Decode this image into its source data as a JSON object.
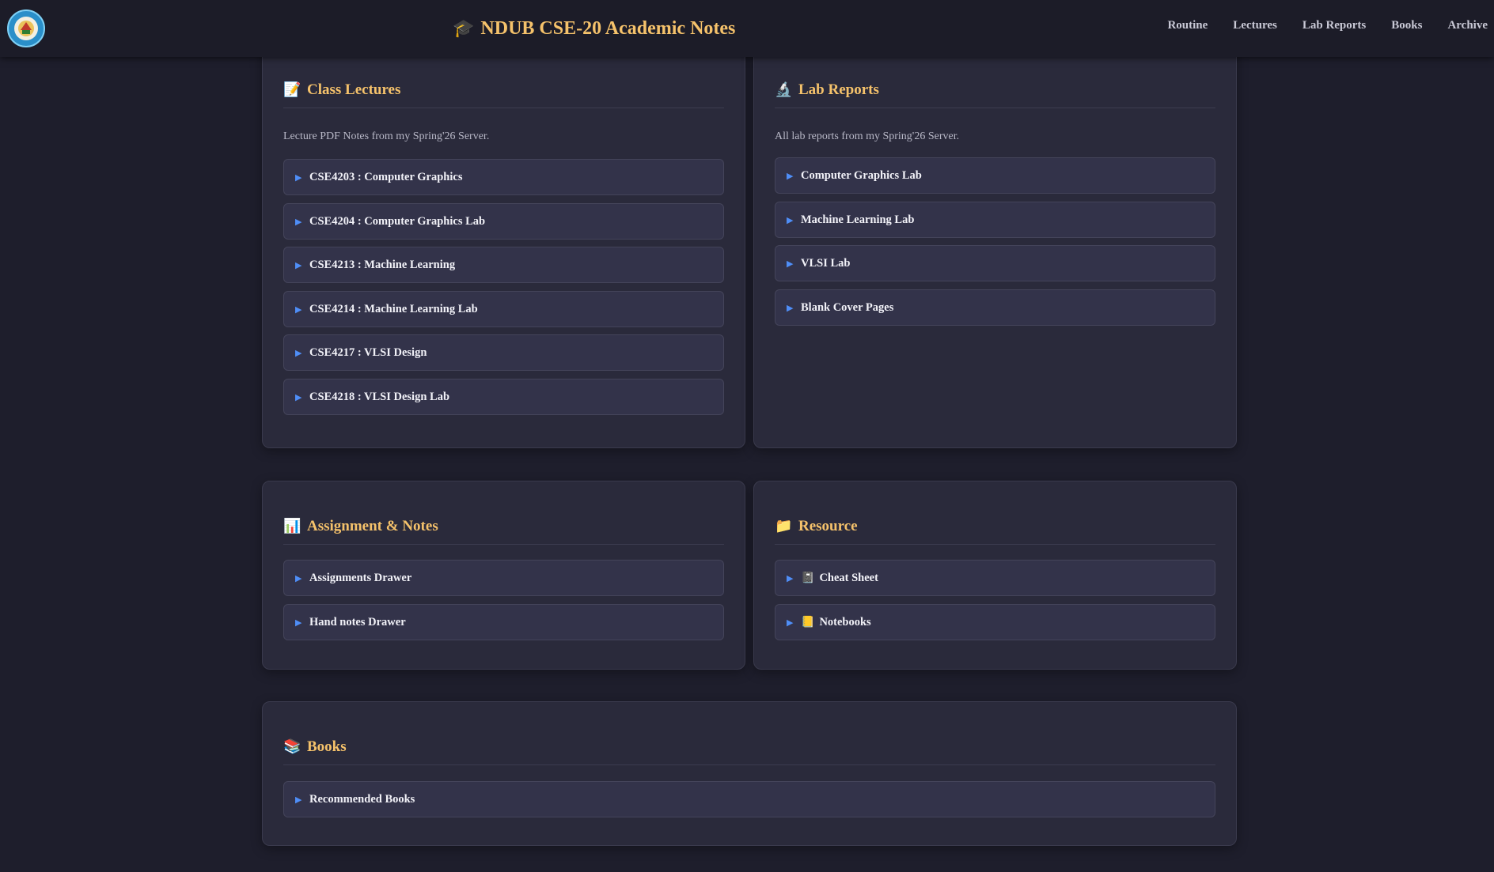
{
  "header": {
    "title": "NDUB CSE-20 Academic Notes",
    "title_icon": "graduation-cap-icon",
    "nav": [
      "Routine",
      "Lectures",
      "Lab Reports",
      "Books",
      "Archive"
    ]
  },
  "colors": {
    "background": "#1e1e2c",
    "card": "#2a2a3b",
    "item": "#33334a",
    "accent_title": "#f5c26b",
    "arrow": "#4f8ef7"
  },
  "lectures": {
    "title": "Class Lectures",
    "icon": "memo-icon",
    "description": "Lecture PDF Notes from my Spring'26 Server.",
    "items": [
      "CSE4203 : Computer Graphics",
      "CSE4204 : Computer Graphics Lab",
      "CSE4213 : Machine Learning",
      "CSE4214 : Machine Learning Lab",
      "CSE4217 : VLSI Design",
      "CSE4218 : VLSI Design Lab"
    ]
  },
  "labs": {
    "title": "Lab Reports",
    "icon": "microscope-icon",
    "description": "All lab reports from my Spring'26 Server.",
    "items": [
      "Computer Graphics Lab",
      "Machine Learning Lab",
      "VLSI Lab",
      "Blank Cover Pages"
    ]
  },
  "assignments": {
    "title": "Assignment & Notes",
    "icon": "bar-chart-icon",
    "items": [
      "Assignments Drawer",
      "Hand notes Drawer"
    ]
  },
  "resource": {
    "title": "Resource",
    "icon": "folder-icon",
    "items": [
      {
        "label": "Cheat Sheet",
        "icon": "notebook-icon"
      },
      {
        "label": "Notebooks",
        "icon": "ledger-icon"
      }
    ]
  },
  "books": {
    "title": "Books",
    "icon": "books-icon",
    "items": [
      "Recommended Books"
    ]
  }
}
